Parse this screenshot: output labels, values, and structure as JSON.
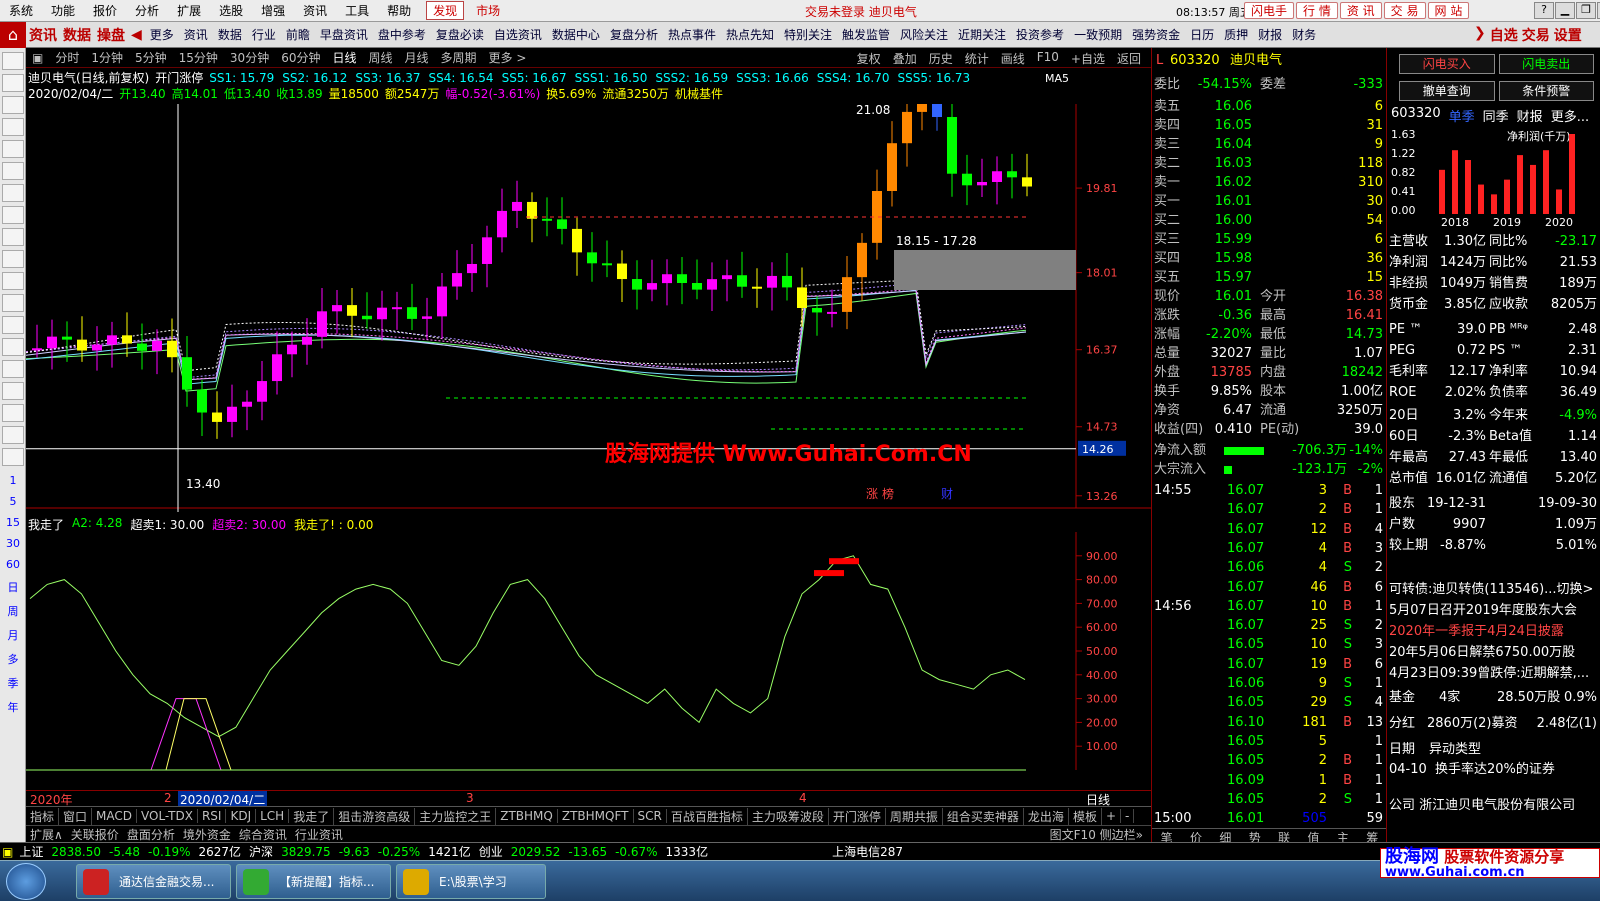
{
  "menubar": {
    "items": [
      "系统",
      "功能",
      "报价",
      "分析",
      "扩展",
      "选股",
      "增强",
      "资讯",
      "工具",
      "帮助"
    ],
    "discover": "发现",
    "market": "市场",
    "center": "交易未登录  迪贝电气",
    "clock": "08:13:57 周五",
    "right_buttons": [
      "闪电手",
      "行  情",
      "资  讯",
      "交  易",
      "网  站"
    ],
    "window_controls": [
      "?",
      "▁",
      "❐",
      "✕"
    ]
  },
  "toolbar": {
    "big": [
      "资讯",
      "数据",
      "操盘"
    ],
    "items": [
      "更多",
      "资讯",
      "数据",
      "行业",
      "前瞻",
      "早盘资讯",
      "盘中参考",
      "复盘必读",
      "自选资讯",
      "数据中心",
      "复盘分析",
      "热点事件",
      "热点先知",
      "特别关注",
      "触发监管",
      "风险关注",
      "近期关注",
      "投资参考",
      "一致预期",
      "强势资金",
      "日历",
      "质押",
      "财报",
      "财务"
    ],
    "right": [
      "自选",
      "交易",
      "设置"
    ]
  },
  "leftbar": {
    "periods": [
      "1",
      "5",
      "15",
      "30",
      "60",
      "日",
      "周",
      "月",
      "多",
      "季",
      "年"
    ]
  },
  "periodbar": {
    "items": [
      "分时",
      "1分钟",
      "5分钟",
      "15分钟",
      "30分钟",
      "60分钟",
      "日线",
      "周线",
      "月线",
      "多周期",
      "更多 >"
    ],
    "active": "日线",
    "right": [
      "复权",
      "叠加",
      "历史",
      "统计",
      "画线",
      "F10",
      "+自选",
      "返回"
    ]
  },
  "chartinfo": {
    "title": "迪贝电气(日线,前复权)",
    "indicator": "开门涨停",
    "ss": [
      "SS1: 15.79",
      "SS2: 16.12",
      "SS3: 16.37",
      "SS4: 16.54",
      "SS5: 16.67",
      "SSS1: 16.50",
      "SSS2: 16.59",
      "SSS3: 16.66",
      "SSS4: 16.70",
      "SSS5: 16.73"
    ],
    "ma": "MA5",
    "date": "2020/02/04/二",
    "open": "开13.40",
    "high": "高14.01",
    "low": "低13.40",
    "close": "收13.89",
    "vol": "量18500",
    "amount": "额2547万",
    "change": "幅-0.52(-3.61%)",
    "turnover": "换5.69%",
    "float": "流通3250万",
    "sector": "机械基件"
  },
  "chart_data": [
    {
      "type": "candlestick",
      "prices": [
        "19.81",
        "18.01",
        "16.37",
        "14.73",
        "13.26"
      ],
      "cursor_price": "14.26",
      "annotations": [
        "21.08",
        "13.40",
        "18.15 - 17.28"
      ],
      "bottom_labels": [
        "涨",
        "榜",
        "财"
      ]
    },
    {
      "type": "line",
      "title": "我走了",
      "values_text": [
        "A2: 4.28",
        "超卖1: 30.00",
        "超卖2: 30.00",
        "我走了! : 0.00"
      ],
      "ticks": [
        "90.00",
        "80.00",
        "70.00",
        "60.00",
        "50.00",
        "40.00",
        "30.00",
        "20.00",
        "10.00"
      ],
      "ylim": [
        0,
        100
      ],
      "values": [
        72,
        78,
        80,
        74,
        62,
        50,
        40,
        32,
        28,
        22,
        18,
        14,
        18,
        30,
        42,
        50,
        58,
        66,
        72,
        76,
        78,
        76,
        70,
        58,
        46,
        44,
        52,
        66,
        78,
        80,
        72,
        60,
        48,
        40,
        36,
        32,
        28,
        34,
        26,
        20,
        34,
        28,
        24,
        30,
        56,
        74,
        80,
        88,
        90,
        78,
        76,
        60,
        42,
        38,
        36,
        34,
        40,
        42,
        38
      ]
    }
  ],
  "timeaxis": {
    "labels": [
      "2020年",
      "2",
      "2020/02/04/二",
      "3",
      "4"
    ],
    "right": "日线"
  },
  "indtabs": [
    "指标",
    "窗口",
    "MACD",
    "VOL-TDX",
    "RSI",
    "KDJ",
    "LCH",
    "我走了",
    "狙击游资高级",
    "主力监控之王",
    "ZTBHMQ",
    "ZTBHMQFT",
    "SCR",
    "百战百胜指标",
    "主力吸筹波段",
    "开门涨停",
    "周期共振",
    "组合买卖神器",
    "龙出海",
    "模板",
    "+",
    "-"
  ],
  "extbar": {
    "items": [
      "扩展∧",
      "关联报价",
      "盘面分析",
      "境外资金",
      "综合资讯",
      "行业资讯"
    ],
    "right": "图文F10  侧边栏»"
  },
  "quote": {
    "code": "603320",
    "name": "迪贝电气",
    "weibi": "-54.15%",
    "weicha": "-333",
    "asks": [
      [
        "卖五",
        "16.06",
        "6"
      ],
      [
        "卖四",
        "16.05",
        "31"
      ],
      [
        "卖三",
        "16.04",
        "9"
      ],
      [
        "卖二",
        "16.03",
        "118"
      ],
      [
        "卖一",
        "16.02",
        "310"
      ]
    ],
    "bids": [
      [
        "买一",
        "16.01",
        "30"
      ],
      [
        "买二",
        "16.00",
        "54"
      ],
      [
        "买三",
        "15.99",
        "6"
      ],
      [
        "买四",
        "15.98",
        "36"
      ],
      [
        "买五",
        "15.97",
        "15"
      ]
    ],
    "stats": [
      [
        "现价",
        "16.01",
        "今开",
        "16.38"
      ],
      [
        "涨跌",
        "-0.36",
        "最高",
        "16.41"
      ],
      [
        "涨幅",
        "-2.20%",
        "最低",
        "14.73"
      ],
      [
        "总量",
        "32027",
        "量比",
        "1.07"
      ],
      [
        "外盘",
        "13785",
        "内盘",
        "18242"
      ],
      [
        "换手",
        "9.85%",
        "股本",
        "1.00亿"
      ],
      [
        "净资",
        "6.47",
        "流通",
        "3250万"
      ],
      [
        "收益(四)",
        "0.410",
        "PE(动)",
        "39.0"
      ]
    ],
    "netflow": [
      "净流入额",
      "-706.3万",
      "-14%"
    ],
    "blockflow": [
      "大宗流入",
      "-123.1万",
      "-2%"
    ],
    "ticks": [
      [
        "14:55",
        "16.07",
        "3",
        "B",
        "1"
      ],
      [
        "",
        "16.07",
        "2",
        "B",
        "1"
      ],
      [
        "",
        "16.07",
        "12",
        "B",
        "4"
      ],
      [
        "",
        "16.07",
        "4",
        "B",
        "3"
      ],
      [
        "",
        "16.06",
        "4",
        "S",
        "2"
      ],
      [
        "",
        "16.07",
        "46",
        "B",
        "6"
      ],
      [
        "14:56",
        "16.07",
        "10",
        "B",
        "1"
      ],
      [
        "",
        "16.07",
        "25",
        "S",
        "2"
      ],
      [
        "",
        "16.05",
        "10",
        "S",
        "3"
      ],
      [
        "",
        "16.07",
        "19",
        "B",
        "6"
      ],
      [
        "",
        "16.06",
        "9",
        "S",
        "1"
      ],
      [
        "",
        "16.05",
        "29",
        "S",
        "4"
      ],
      [
        "",
        "16.10",
        "181",
        "B",
        "13"
      ],
      [
        "",
        "16.05",
        "5",
        "",
        "1"
      ],
      [
        "",
        "16.05",
        "2",
        "B",
        "1"
      ],
      [
        "",
        "16.09",
        "1",
        "B",
        "1"
      ],
      [
        "",
        "16.05",
        "2",
        "S",
        "1"
      ],
      [
        "15:00",
        "16.01",
        "505",
        "",
        "59"
      ]
    ],
    "bottom_tabs": [
      "笔",
      "价",
      "细",
      "势",
      "联",
      "值",
      "主",
      "筹"
    ]
  },
  "fund": {
    "buttons": [
      "闪电买入",
      "闪电卖出",
      "撤单查询",
      "条件预警"
    ],
    "code": "603320",
    "tabs": [
      "单季",
      "同季",
      "财报",
      "更多..."
    ],
    "chart_label": "净利润(千万)",
    "yticks": [
      "1.63",
      "1.22",
      "0.82",
      "0.41",
      "0.00"
    ],
    "years": [
      "2018",
      "2019",
      "2020"
    ],
    "bars": [
      0.9,
      1.3,
      1.1,
      0.6,
      0.4,
      0.7,
      1.2,
      1.0,
      1.3,
      0.5,
      1.63
    ],
    "rows": [
      [
        "主营收",
        "1.30亿",
        "同比%",
        "-23.17"
      ],
      [
        "净利润",
        "1424万",
        "同比%",
        "21.53"
      ],
      [
        "非经损",
        "1049万",
        "销售费",
        "189万"
      ],
      [
        "货币金",
        "3.85亿",
        "应收款",
        "8205万"
      ],
      [
        "PE ™",
        "39.0",
        "PB ᴹᴿᵠ",
        "2.48"
      ],
      [
        "PEG",
        "0.72",
        "PS ™",
        "2.31"
      ],
      [
        "毛利率",
        "12.17",
        "净利率",
        "10.94"
      ],
      [
        "ROE",
        "2.02%",
        "负债率",
        "36.49"
      ],
      [
        "20日",
        "3.2%",
        "今年来",
        "-4.9%"
      ],
      [
        "60日",
        "-2.3%",
        "Beta值",
        "1.14"
      ],
      [
        "年最高",
        "27.43",
        "年最低",
        "13.40"
      ],
      [
        "总市值",
        "16.01亿",
        "流通值",
        "5.20亿"
      ],
      [
        "股东",
        "19-12-31",
        "",
        "19-09-30"
      ],
      [
        "户数",
        "9907",
        "",
        "1.09万"
      ],
      [
        "较上期",
        "-8.87%",
        "",
        "5.01%"
      ]
    ],
    "news": [
      "可转债:迪贝转债(113546)...切换>",
      "5月07日召开2019年度股东大会",
      "2020年一季报于4月24日披露",
      "20年5月06日解禁6750.00万股",
      "4月23日09:39曾跌停:近期解禁,..."
    ],
    "fundrow": [
      "基金",
      "4家",
      "28.50万股",
      "0.9%"
    ],
    "divrow": [
      "分红",
      "2860万(2)募资",
      "",
      "2.48亿(1)"
    ],
    "daterow": [
      "日期",
      "异动类型"
    ],
    "eventrow": [
      "04-10",
      "换手率达20%的证券"
    ],
    "company": "公司  浙江迪贝电气股份有限公司"
  },
  "statusbar": [
    [
      "上证",
      "2838.50",
      "-5.48",
      "-0.19%",
      "2627亿"
    ],
    [
      "沪深",
      "3829.75",
      "-9.63",
      "-0.25%",
      "1421亿"
    ],
    [
      "创业",
      "2029.52",
      "-13.65",
      "-0.67%",
      "1333亿"
    ]
  ],
  "statusbar_extra": "上海电信287",
  "taskbar": {
    "tasks": [
      "通达信金融交易...",
      "【新提醒】指标...",
      "E:\\股票\\学习"
    ]
  },
  "watermark": {
    "site": "股海网",
    "slogan": "股票软件资源分享",
    "url": "www.Guhai.com.cn"
  },
  "overlay": "股海网提供  Www.Guhai.Com.CN",
  "colors": {
    "up": "#ff00ff",
    "down": "#00ff00",
    "red": "#ff3030",
    "cyan": "#00ffff",
    "yellow": "#ffff00"
  }
}
